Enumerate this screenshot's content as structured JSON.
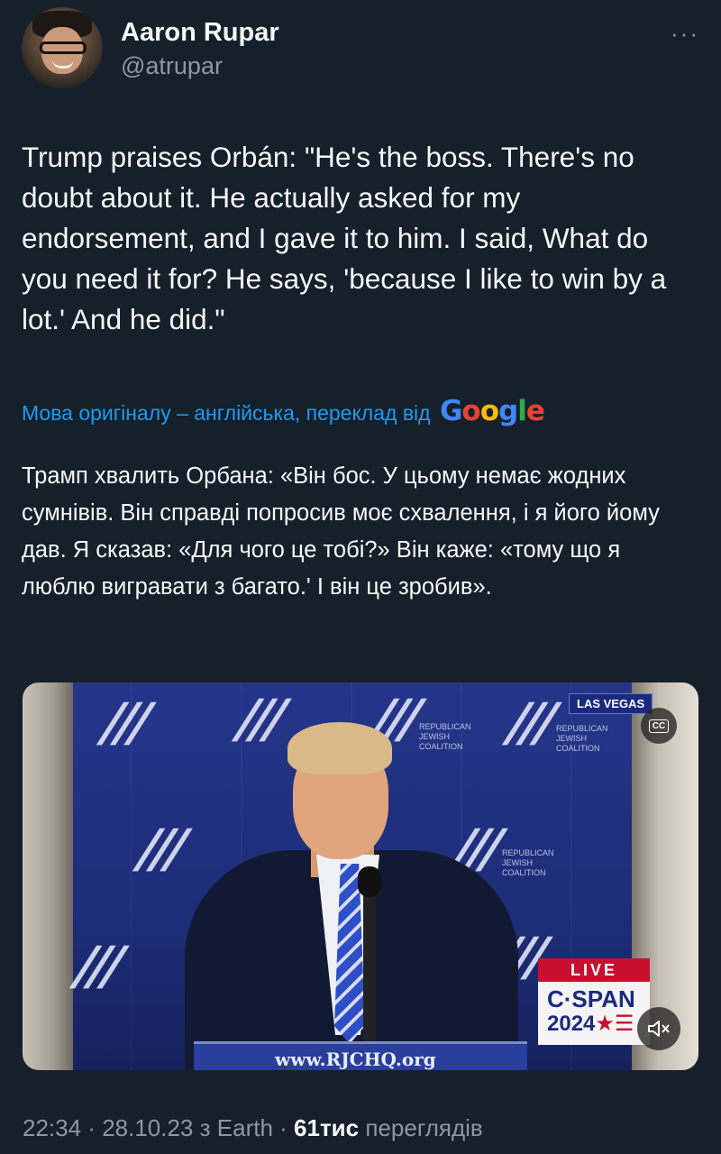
{
  "author": {
    "name": "Aaron Rupar",
    "handle": "@atrupar",
    "more_glyph": "···"
  },
  "tweet": {
    "text": "Trump praises Orbán: \"He's the boss. There's no doubt about it. He actually asked for my endorsement, and I gave it to him. I said, What do you need it for? He says, 'because I like to win by a lot.' And he did.\"",
    "translation_notice": "Мова оригіналу – англійська, переклад від",
    "translation_provider": "Google",
    "translated_text": "Трамп хвалить Орбана: «Він бос. У цьому немає жодних сумнівів. Він справді попросив моє схвалення, і я його йому дав. Я сказав: «Для чого це тобі?» Він каже: «тому що я люблю вигравати з багато.' І він це зробив»."
  },
  "video": {
    "location_badge": "LAS VEGAS",
    "cc_label": "CC",
    "live_label": "LIVE",
    "network_name": "C·SPAN",
    "network_year": "2024",
    "network_year_suffix": "★☰",
    "podium_text": "www.RJCHQ.org",
    "backdrop_mark": "///",
    "backdrop_caption": "REPUBLICAN JEWISH COALITION",
    "mute_icon": "speaker-muted-icon"
  },
  "meta": {
    "time": "22:34",
    "sep1": " · ",
    "date": "28.10.23",
    "via": " з Earth",
    "sep2": " · ",
    "views_count": "61тис",
    "views_label": " переглядів"
  },
  "colors": {
    "background": "#15202b",
    "text": "#f7f9f9",
    "secondary": "#8b98a5",
    "link": "#1d9bf0",
    "live_red": "#c8102e",
    "cspan_blue": "#1a2a80"
  }
}
